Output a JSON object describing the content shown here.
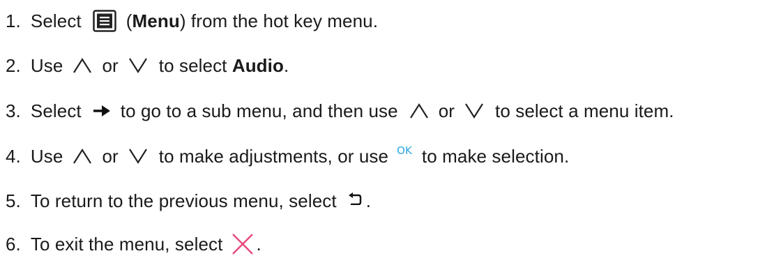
{
  "steps": [
    {
      "num": "1.",
      "text_a": "Select",
      "text_b": "(",
      "bold": "Menu",
      "text_c": ") from the hot key menu."
    },
    {
      "num": "2.",
      "text_a": "Use",
      "text_b": "or",
      "text_c": "to select ",
      "bold": "Audio",
      "text_d": "."
    },
    {
      "num": "3.",
      "text_a": "Select",
      "text_b": "to go to a sub menu, and then use",
      "text_c": "or",
      "text_d": "to select a menu item."
    },
    {
      "num": "4.",
      "text_a": "Use",
      "text_b": "or",
      "text_c": "to make adjustments, or use",
      "ok": "OK",
      "text_d": "to make selection."
    },
    {
      "num": "5.",
      "text_a": "To return to the previous menu, select",
      "text_b": "."
    },
    {
      "num": "6.",
      "text_a": "To exit the menu, select",
      "text_b": "."
    }
  ],
  "icons": {
    "menu": "menu-icon",
    "up": "up-arrow-icon",
    "down": "down-arrow-icon",
    "right": "right-arrow-icon",
    "back": "back-icon",
    "close": "close-icon"
  },
  "colors": {
    "ok": "#2aa6e0",
    "close": "#e8487a"
  }
}
